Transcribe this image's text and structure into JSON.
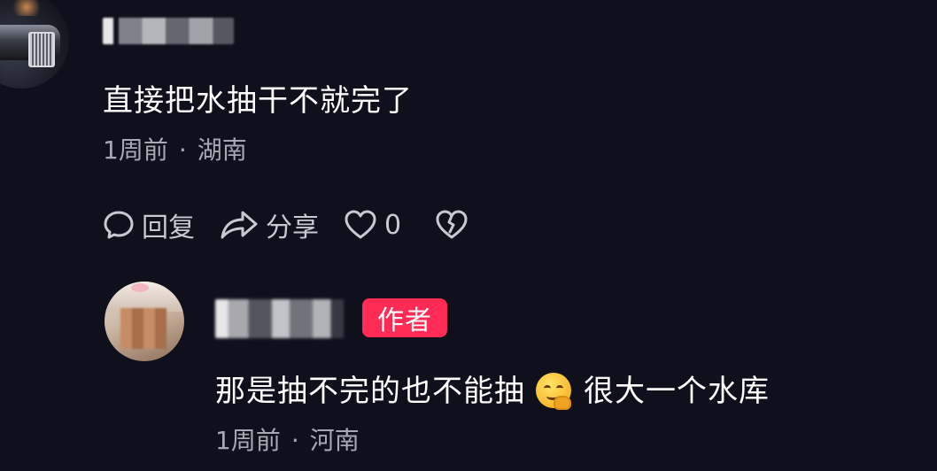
{
  "comment": {
    "text": "直接把水抽干不就完了",
    "time": "1周前",
    "separator": "·",
    "location": "湖南",
    "actions": {
      "reply_label": "回复",
      "share_label": "分享",
      "like_count": "0"
    }
  },
  "reply": {
    "author_badge": "作者",
    "text_before_emoji": "那是抽不完的也不能抽",
    "emoji": "smirk-hand-over-mouth-emoji",
    "text_after_emoji": "很大一个水库",
    "time": "1周前",
    "separator": "·",
    "location": "河南"
  },
  "colors": {
    "background": "#0f101c",
    "badge": "#fe2c55",
    "meta_text": "#a6a8b2"
  }
}
